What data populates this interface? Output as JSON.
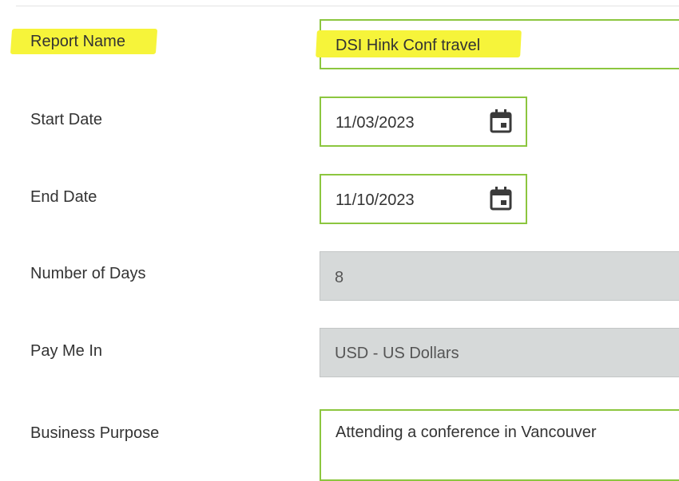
{
  "form": {
    "report_name": {
      "label": "Report Name",
      "value": "DSI Hink Conf travel"
    },
    "start_date": {
      "label": "Start Date",
      "value": "11/03/2023"
    },
    "end_date": {
      "label": "End Date",
      "value": "11/10/2023"
    },
    "number_of_days": {
      "label": "Number of Days",
      "value": "8"
    },
    "pay_me_in": {
      "label": "Pay Me In",
      "value": "USD - US Dollars"
    },
    "business_purpose": {
      "label": "Business Purpose",
      "value": "Attending a conference in Vancouver"
    }
  },
  "icons": {
    "date_picker": "calendar-icon"
  },
  "colors": {
    "field_border": "#8cc63f",
    "readonly_bg": "#d6d9d9",
    "highlight": "#f6f43a"
  }
}
